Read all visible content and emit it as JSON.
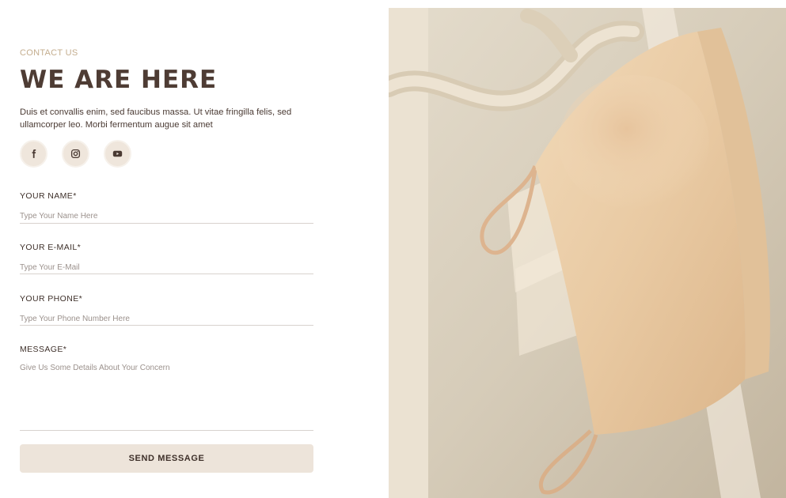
{
  "header": {
    "eyebrow": "CONTACT US",
    "title": "WE ARE HERE",
    "description": "Duis et convallis enim, sed faucibus massa. Ut vitae fringilla felis, sed ullamcorper leo. Morbi fermentum augue sit amet"
  },
  "socials": [
    {
      "icon": "facebook-icon"
    },
    {
      "icon": "instagram-icon"
    },
    {
      "icon": "youtube-icon"
    }
  ],
  "form": {
    "name": {
      "label": "YOUR NAME*",
      "placeholder": "Type Your Name Here",
      "value": ""
    },
    "email": {
      "label": "YOUR E-MAIL*",
      "placeholder": "Type Your E-Mail",
      "value": ""
    },
    "phone": {
      "label": "YOUR PHONE*",
      "placeholder": "Type Your Phone Number Here",
      "value": ""
    },
    "message": {
      "label": "MESSAGE*",
      "placeholder": "Give Us Some Details About Your Concern",
      "value": ""
    },
    "submit_label": "SEND MESSAGE"
  },
  "colors": {
    "heading": "#4e3c34",
    "eyebrow": "#c4ad8e",
    "button_bg": "#ede4da",
    "social_bg": "#efe6dc"
  }
}
